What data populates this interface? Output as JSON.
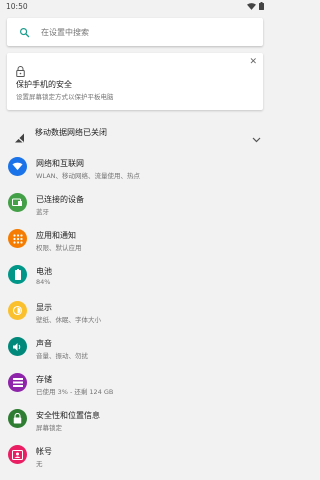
{
  "status_bar": {
    "time": "10:50"
  },
  "search": {
    "placeholder": "在设置中搜索"
  },
  "suggestion": {
    "title": "保护手机的安全",
    "subtitle": "设置屏幕锁定方式以保护平板电脑"
  },
  "condition": {
    "label": "移动数据网络已关闭"
  },
  "settings": [
    {
      "label": "网络和互联网",
      "summary": "WLAN、移动网络、流量使用、热点",
      "color": "#1a73e8",
      "icon": "wifi-icon"
    },
    {
      "label": "已连接的设备",
      "summary": "蓝牙",
      "color": "#43a047",
      "icon": "devices-icon"
    },
    {
      "label": "应用和通知",
      "summary": "权限、默认应用",
      "color": "#f57c00",
      "icon": "apps-icon"
    },
    {
      "label": "电池",
      "summary": "84%",
      "color": "#009688",
      "icon": "battery-icon"
    },
    {
      "label": "显示",
      "summary": "壁纸、休眠、字体大小",
      "color": "#fbc02d",
      "icon": "brightness-icon"
    },
    {
      "label": "声音",
      "summary": "音量、振动、勿扰",
      "color": "#00897b",
      "icon": "volume-icon"
    },
    {
      "label": "存储",
      "summary": "已使用 3% - 还剩 124 GB",
      "color": "#8e24aa",
      "icon": "storage-icon"
    },
    {
      "label": "安全性和位置信息",
      "summary": "屏幕锁定",
      "color": "#2e7d32",
      "icon": "lock-icon"
    },
    {
      "label": "帐号",
      "summary": "无",
      "color": "#e91e63",
      "icon": "account-icon"
    }
  ]
}
